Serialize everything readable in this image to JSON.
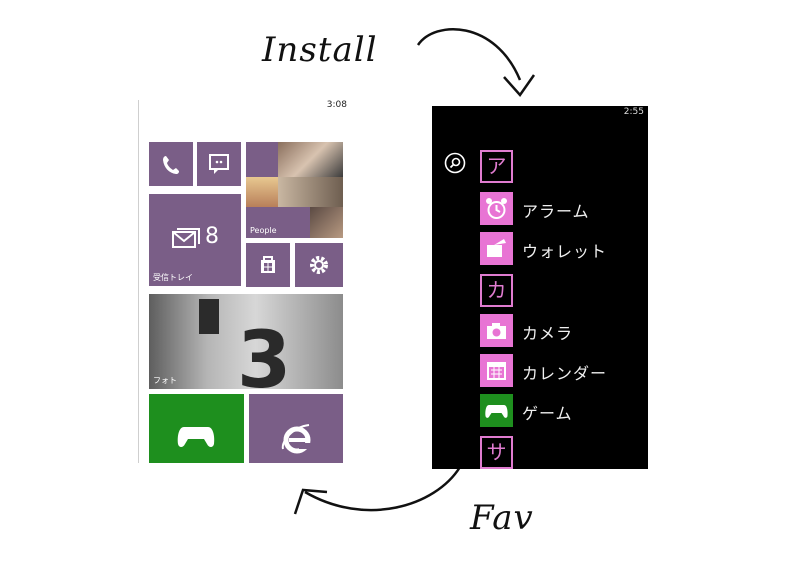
{
  "annotations": {
    "install_label": "Install",
    "fav_label": "Fav"
  },
  "left_phone": {
    "status_time": "3:08",
    "tiles": {
      "people_label": "People",
      "mail_count": "8",
      "mail_label": "受信トレイ",
      "photos_label": "フォト"
    },
    "colors": {
      "tile": "#7a5e87",
      "xbox": "#1e8f1e"
    }
  },
  "right_phone": {
    "status_time": "2:55",
    "groups": [
      {
        "letter": "ア",
        "apps": [
          "アラーム",
          "ウォレット"
        ]
      },
      {
        "letter": "カ",
        "apps": [
          "カメラ",
          "カレンダー",
          "ゲーム"
        ]
      },
      {
        "letter": "サ",
        "apps": []
      }
    ],
    "icons": [
      "search-icon",
      "alarm-icon",
      "wallet-icon",
      "camera-icon",
      "calendar-icon",
      "xbox-controller-icon"
    ],
    "colors": {
      "accent": "#e874d4",
      "xbox": "#1e8f1e"
    }
  }
}
